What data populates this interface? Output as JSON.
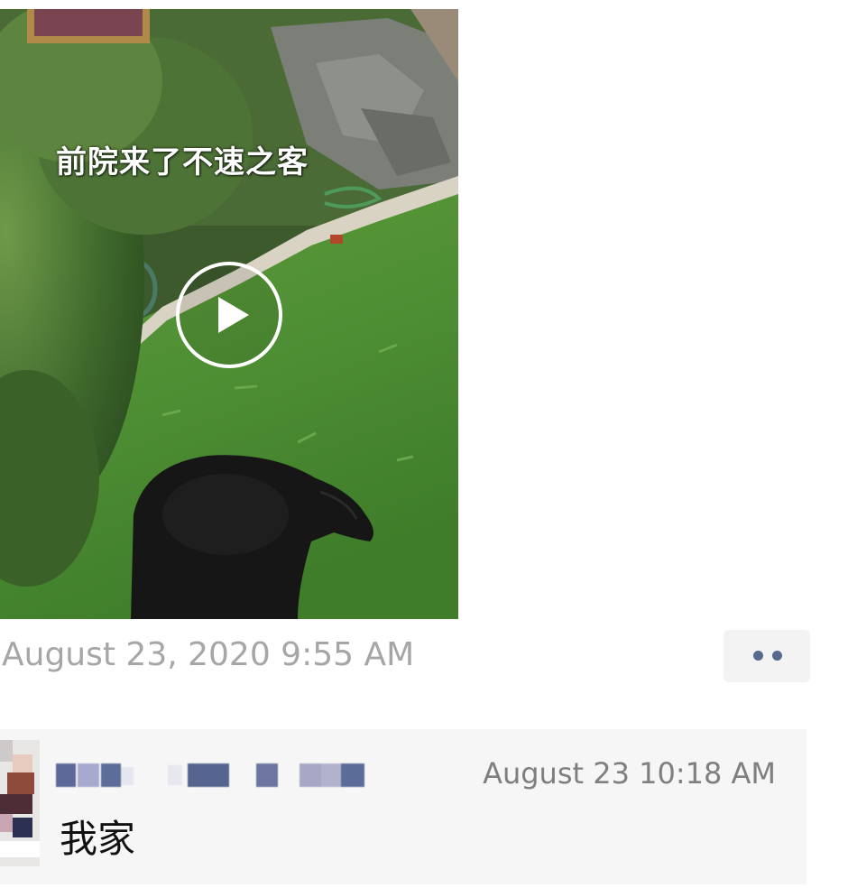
{
  "post": {
    "video": {
      "caption": "前院来了不速之客"
    },
    "timestamp": "August 23, 2020 9:55 AM"
  },
  "comment": {
    "author_name_redacted": true,
    "timestamp": "August 23 10:18 AM",
    "text": "我家"
  },
  "icons": {
    "play": "play-circle-icon",
    "more": "more-dots-icon"
  },
  "colors": {
    "timestamp_gray": "#a6a6a6",
    "more_dots": "#56698f",
    "comment_bg": "#f6f6f6"
  }
}
